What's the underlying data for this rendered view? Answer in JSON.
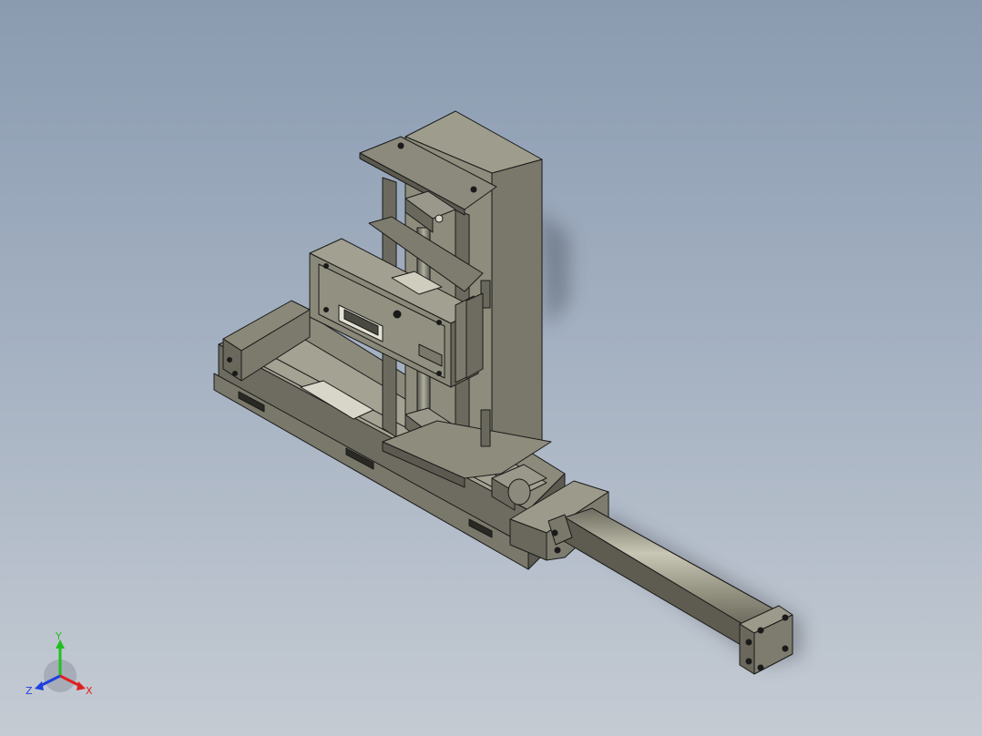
{
  "viewport": {
    "background_top": "#8a9bb0",
    "background_bottom": "#c5cbd3"
  },
  "model": {
    "description_icon": "cad-assembly-model",
    "body_color": "#8c8a7a",
    "edge_color": "#1a1a1a"
  },
  "triad": {
    "x_label": "X",
    "y_label": "Y",
    "z_label": "Z",
    "x_color": "#e02020",
    "y_color": "#20c020",
    "z_color": "#2040e0"
  }
}
